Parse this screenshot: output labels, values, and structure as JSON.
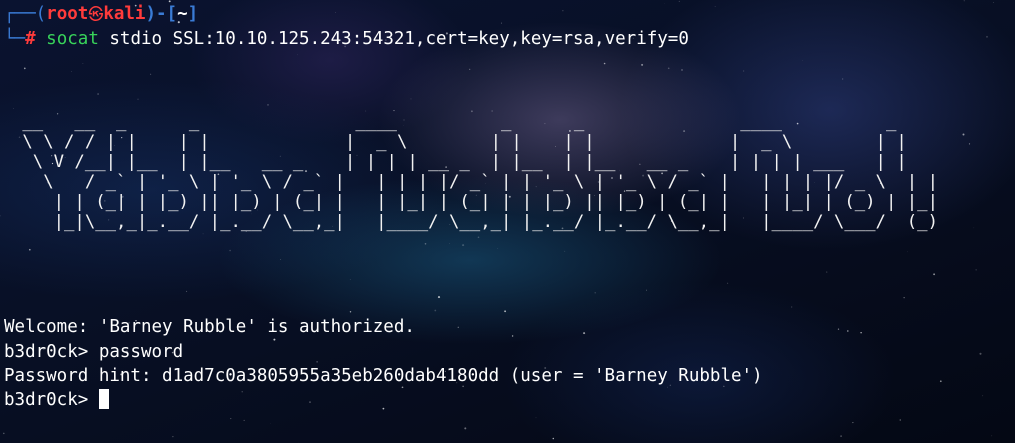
{
  "prompt_header": {
    "corner": "┌──(",
    "user": "root",
    "skull_icon": "㉿",
    "host": "kali",
    "mid": ")-[",
    "path": "~",
    "close": "]"
  },
  "command_line": {
    "corner": "└─",
    "hash": "#",
    "program": "socat",
    "args": " stdio SSL:10.10.125.243:54321,cert=key,key=rsa,verify=0"
  },
  "banner_ascii": " __   __  _      _               ____          _      _               ____          _ \n \\ \\ / / | |    | |             |  _ \\        | |    | |             |  _ \\        | |\n  \\ V /__| |__  | |__   __ _    | | | | __ _  | |__  | |__   __ _    | | | | ___   | |\n   \\   / _` | '_ \\ | '_ \\ / _` |   | | | |/ _` | | '_ \\ | '_ \\ / _` |   | | | |/ _ \\  | |\n    | | (_| | |_) || |_) | (_| |   | |_| | (_| | | |_) || |_) | (_| |   | |_| | (_) | |_|\n    |_|\\__,_|_.__/ |_.__/ \\__,_|   |____/ \\__,_| |_.__/ |_.__/ \\__,_|   |____/ \\___/  (_)",
  "output": {
    "welcome": "Welcome: 'Barney Rubble' is authorized.",
    "prompt1": "b3dr0ck> ",
    "input1": "password",
    "hint": "Password hint: d1ad7c0a3805955a35eb260dab4180dd (user = 'Barney Rubble')",
    "prompt2": "b3dr0ck> "
  },
  "colors": {
    "prompt_frame": "#3a7bd5",
    "user_host": "#ff3b3b",
    "command": "#38d35a",
    "text": "#ffffff"
  }
}
